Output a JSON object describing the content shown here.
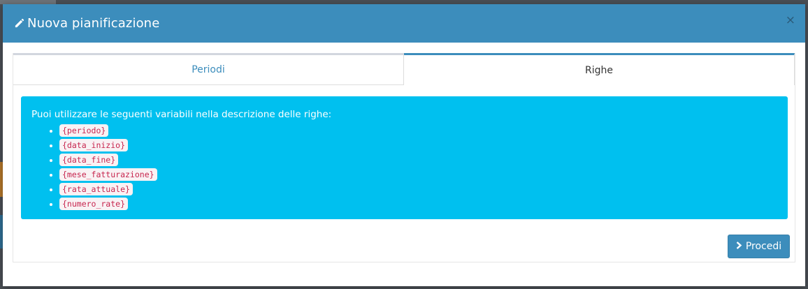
{
  "modal": {
    "title": "Nuova pianificazione",
    "title_icon": "pencil-icon",
    "close_label": "×"
  },
  "tabs": [
    {
      "label": "Periodi",
      "active": false
    },
    {
      "label": "Righe",
      "active": true
    }
  ],
  "callout": {
    "intro": "Puoi utilizzare le seguenti variabili nella descrizione delle righe:",
    "variables": [
      "{periodo}",
      "{data_inizio}",
      "{data_fine}",
      "{mese_fatturazione}",
      "{rata_attuale}",
      "{numero_rate}"
    ]
  },
  "actions": {
    "proceed_label": "Procedi",
    "proceed_icon": "chevron-right-icon"
  },
  "colors": {
    "header": "#3c8dbc",
    "callout": "#00c0ef",
    "code_text": "#c7254e",
    "code_bg": "#f9f2f4"
  }
}
